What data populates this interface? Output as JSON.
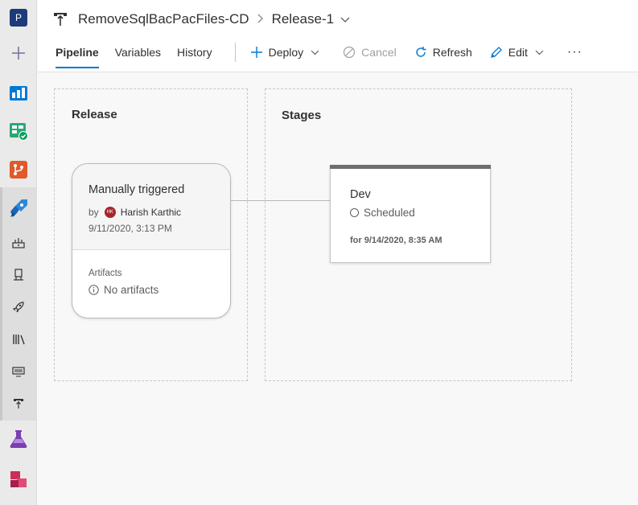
{
  "rail": {
    "project_initial": "P",
    "colors": {
      "project": "#1f3a7a",
      "boards": "#0078d4",
      "repos": "#e05a2a",
      "test": "#7a3fb0",
      "artifacts": "#cc2d5a"
    }
  },
  "header": {
    "pipeline_name": "RemoveSqlBacPacFiles-CD",
    "release_name": "Release-1"
  },
  "tabs": [
    {
      "label": "Pipeline",
      "active": true
    },
    {
      "label": "Variables",
      "active": false
    },
    {
      "label": "History",
      "active": false
    }
  ],
  "toolbar": {
    "deploy_label": "Deploy",
    "cancel_label": "Cancel",
    "refresh_label": "Refresh",
    "edit_label": "Edit",
    "more_label": "···"
  },
  "release_panel": {
    "title": "Release",
    "card": {
      "trigger": "Manually triggered",
      "by_label": "by",
      "avatar_initials": "HK",
      "user": "Harish Karthic",
      "date": "9/11/2020, 3:13 PM",
      "artifacts_label": "Artifacts",
      "artifacts_value": "No artifacts"
    }
  },
  "stages_panel": {
    "title": "Stages",
    "stage": {
      "name": "Dev",
      "status": "Scheduled",
      "when": "for 9/14/2020, 8:35 AM"
    }
  }
}
